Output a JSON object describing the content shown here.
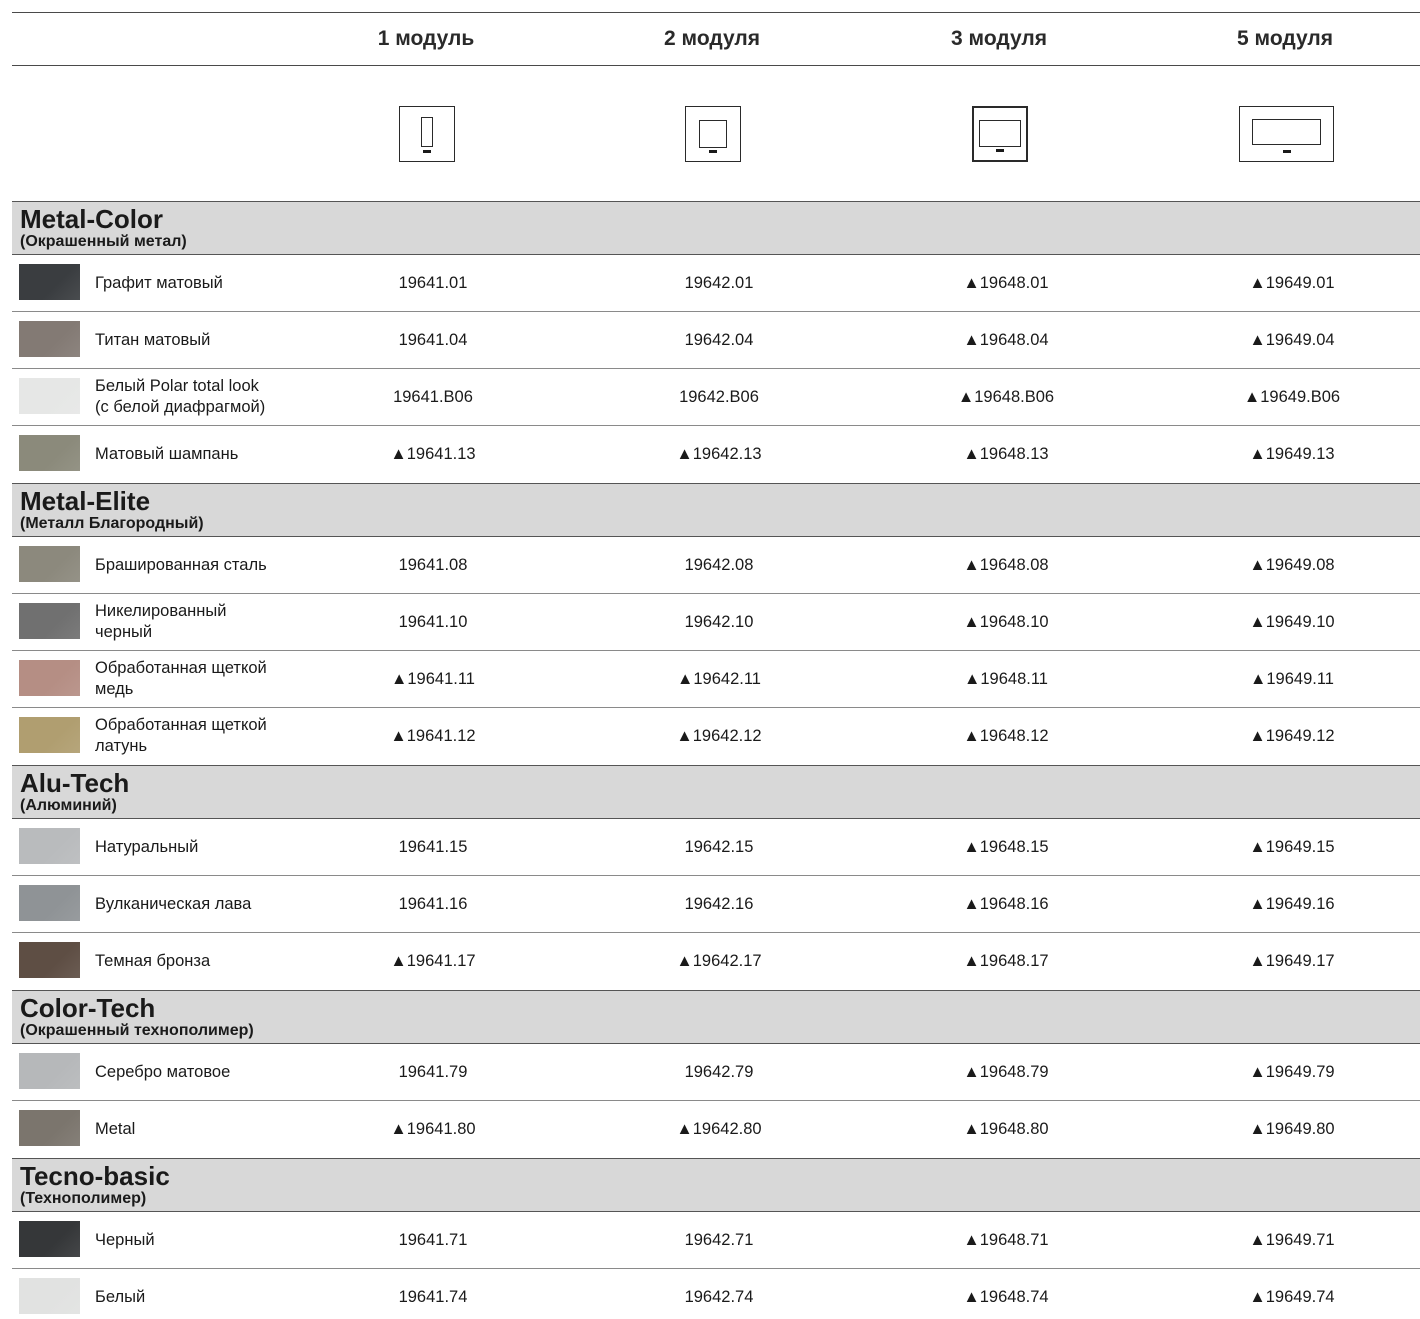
{
  "columns": [
    "1 модуль",
    "2 модуля",
    "3 модуля",
    "5 модуля"
  ],
  "icons": [
    "plate-1-module-icon",
    "plate-2-module-icon",
    "plate-3-module-icon",
    "plate-5-module-icon"
  ],
  "sections": [
    {
      "title": "Metal-Color",
      "subtitle": "(Окрашенный метал)",
      "rows": [
        {
          "name": "Графит матовый",
          "color": "#3a3d40",
          "codes": [
            "19641.01",
            "19642.01",
            "▲19648.01",
            "▲19649.01"
          ]
        },
        {
          "name": "Титан матовый",
          "color": "#837a74",
          "codes": [
            "19641.04",
            "19642.04",
            "▲19648.04",
            "▲19649.04"
          ]
        },
        {
          "name": "Белый Polar total look\n(с белой диафрагмой)",
          "color": "#e6e7e6",
          "codes": [
            "19641.B06",
            "19642.B06",
            "▲19648.B06",
            "▲19649.B06"
          ]
        },
        {
          "name": "Матовый шампань",
          "color": "#8b8a7b",
          "codes": [
            "▲19641.13",
            "▲19642.13",
            "▲19648.13",
            "▲19649.13"
          ]
        }
      ]
    },
    {
      "title": "Metal-Elite",
      "subtitle": "(Металл Благородный)",
      "rows": [
        {
          "name": "Брашированная сталь",
          "color": "#8c897d",
          "codes": [
            "19641.08",
            "19642.08",
            "▲19648.08",
            "▲19649.08"
          ]
        },
        {
          "name": "Никелированный\nчерный",
          "color": "#707070",
          "codes": [
            "19641.10",
            "19642.10",
            "▲19648.10",
            "▲19649.10"
          ]
        },
        {
          "name": "Обработанная щеткой\nмедь",
          "color": "#b58e84",
          "codes": [
            "▲19641.11",
            "▲19642.11",
            "▲19648.11",
            "▲19649.11"
          ]
        },
        {
          "name": "Обработанная щеткой\nлатунь",
          "color": "#b09e70",
          "codes": [
            "▲19641.12",
            "▲19642.12",
            "▲19648.12",
            "▲19649.12"
          ]
        }
      ]
    },
    {
      "title": "Alu-Tech",
      "subtitle": "(Алюминий)",
      "rows": [
        {
          "name": "Натуральный",
          "color": "#b9bbbd",
          "codes": [
            "19641.15",
            "19642.15",
            "▲19648.15",
            "▲19649.15"
          ]
        },
        {
          "name": "Вулканическая лава",
          "color": "#8f9396",
          "codes": [
            "19641.16",
            "19642.16",
            "▲19648.16",
            "▲19649.16"
          ]
        },
        {
          "name": "Темная бронза",
          "color": "#5e4e44",
          "codes": [
            "▲19641.17",
            "▲19642.17",
            "▲19648.17",
            "▲19649.17"
          ]
        }
      ]
    },
    {
      "title": "Color-Tech",
      "subtitle": "(Окрашенный технополимер)",
      "rows": [
        {
          "name": "Серебро матовое",
          "color": "#b6b8ba",
          "codes": [
            "19641.79",
            "19642.79",
            "▲19648.79",
            "▲19649.79"
          ]
        },
        {
          "name": "Metal",
          "color": "#7b756d",
          "codes": [
            "▲19641.80",
            "▲19642.80",
            "▲19648.80",
            "▲19649.80"
          ]
        }
      ]
    },
    {
      "title": "Tecno-basic",
      "subtitle": "(Технополимер)",
      "rows": [
        {
          "name": "Черный",
          "color": "#353739",
          "codes": [
            "19641.71",
            "19642.71",
            "▲19648.71",
            "▲19649.71"
          ]
        },
        {
          "name": "Белый",
          "color": "#e1e2e1",
          "codes": [
            "19641.74",
            "19642.74",
            "▲19648.74",
            "▲19649.74"
          ]
        }
      ]
    }
  ]
}
